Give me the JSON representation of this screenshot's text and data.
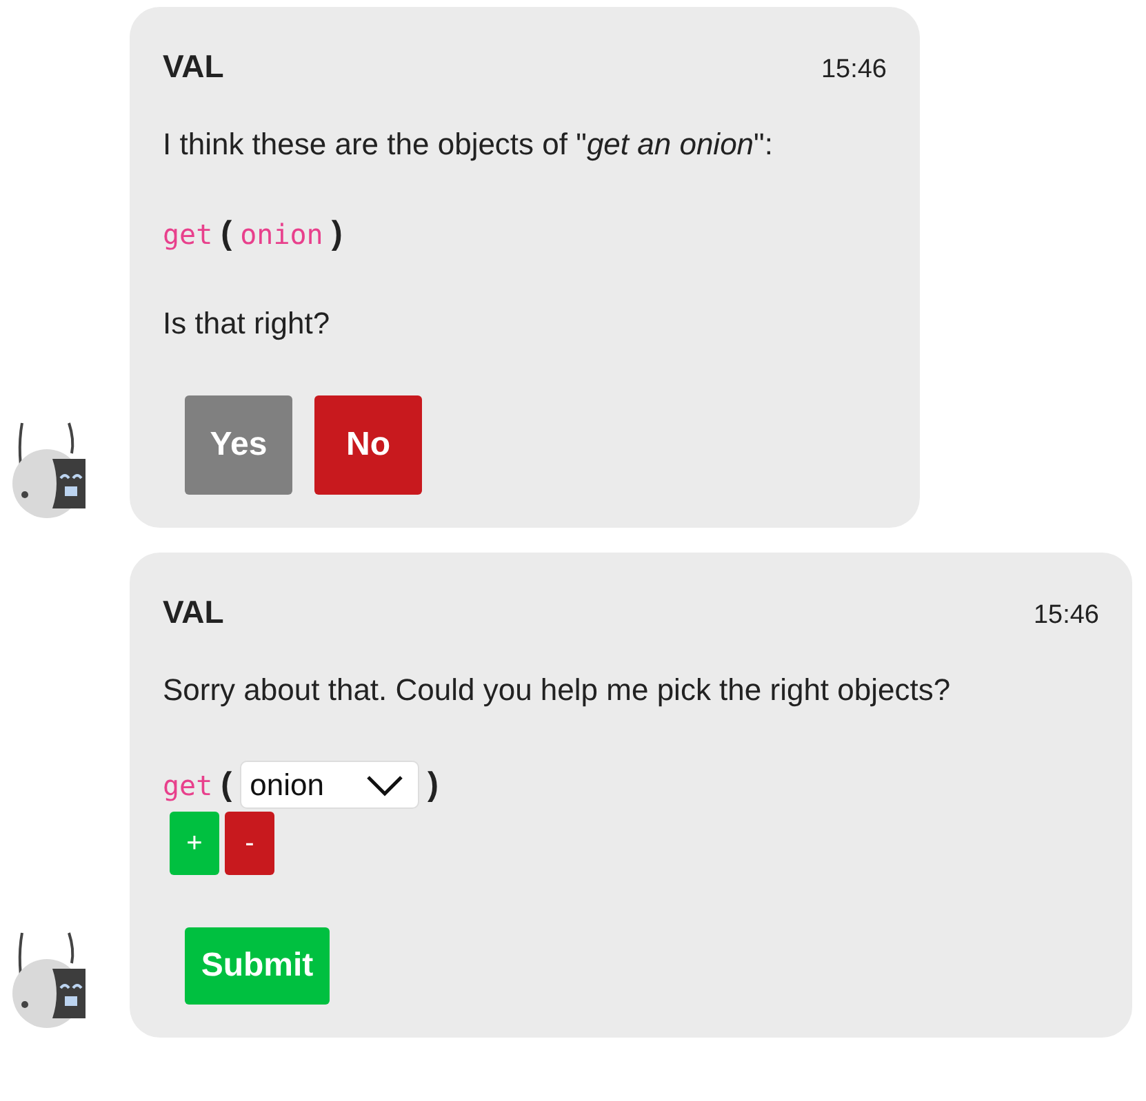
{
  "messages": [
    {
      "sender": "VAL",
      "time": "15:46",
      "blocks": [
        {
          "kind": "text",
          "text": "I think these are the objects of \"*get an onion*\":"
        },
        {
          "kind": "expression",
          "verb": "get",
          "open": "(",
          "close": ")",
          "args": [
            {
              "kind": "plain",
              "text": "onion"
            }
          ]
        },
        {
          "kind": "text",
          "text": "Is that right?"
        },
        {
          "kind": "answer_buttons",
          "buttons": [
            {
              "label": "Yes",
              "kind": "neutral"
            },
            {
              "label": "No",
              "kind": "danger"
            }
          ]
        }
      ]
    },
    {
      "sender": "VAL",
      "time": "15:46",
      "blocks": [
        {
          "kind": "text",
          "text": "Sorry about that. Could you help me pick the right objects?"
        },
        {
          "kind": "expression",
          "verb": "get",
          "open": "(",
          "close": ")",
          "args": [
            {
              "kind": "select",
              "text": "onion"
            }
          ]
        },
        {
          "kind": "edit_buttons",
          "buttons": [
            {
              "label": "+",
              "kind": "add"
            },
            {
              "label": "-",
              "kind": "danger"
            }
          ]
        },
        {
          "kind": "submit_buttons",
          "buttons": [
            {
              "label": "Submit",
              "kind": "add"
            }
          ]
        }
      ]
    }
  ]
}
